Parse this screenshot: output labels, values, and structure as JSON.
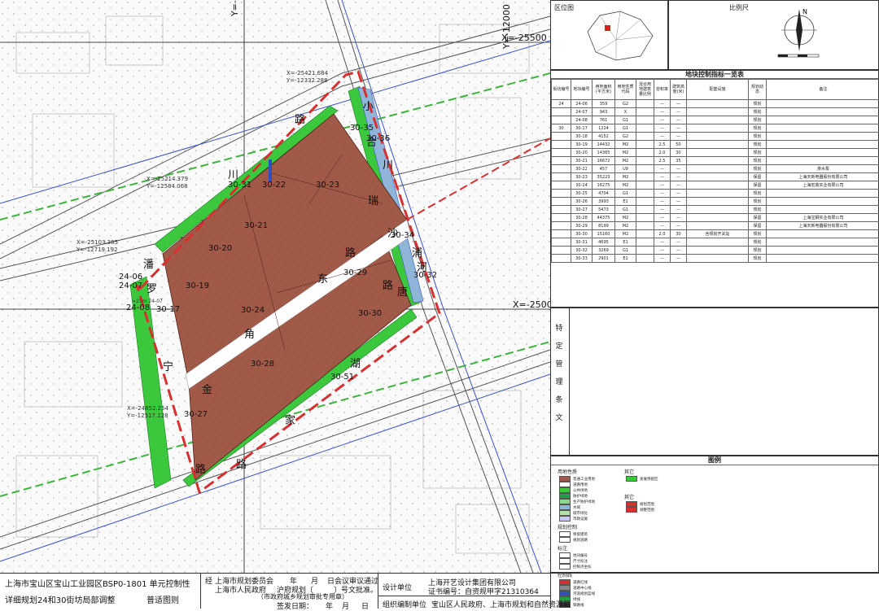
{
  "map": {
    "parcels": [
      "30-35",
      "30-36",
      "30-31",
      "30-22",
      "30-23",
      "30-21",
      "30-20",
      "30-19",
      "30-24",
      "30-17",
      "30-34",
      "30-32",
      "30-29",
      "30-30",
      "30-28",
      "30-51",
      "30-27",
      "24-06",
      "24-07",
      "24-08"
    ],
    "roads": [
      "路",
      "小",
      "川",
      "合",
      "川",
      "瑞",
      "罗",
      "潘",
      "东",
      "路",
      "宁",
      "角",
      "金",
      "路",
      "沙",
      "浦",
      "唐",
      "湖",
      "家",
      "路",
      "路",
      "河"
    ],
    "grid_labels": [
      "Y=-12500",
      "Y=-12000",
      "X=-25500",
      "X=-25000"
    ],
    "coords": [
      "X=-25421.684",
      "Y=-12332.288",
      "X=-25214.379",
      "Y=-12584.068",
      "X=-25103.385",
      "Y=-12719.192",
      "X=-24852.254",
      "Y=-12517.128"
    ],
    "dot_note": "≈25m 24-07"
  },
  "location_box": {
    "title": "区位图"
  },
  "scale_box": {
    "title": "比例尺",
    "north": "N"
  },
  "table": {
    "title": "地块控制指标一览表",
    "headers": [
      "街坊编号",
      "地块编号",
      "用地面积(平方米)",
      "用地性质代码",
      "混合用地建筑量比例",
      "容积率",
      "建筑高度(米)",
      "配套设施",
      "规划动态",
      "备注"
    ],
    "rows": [
      [
        "24",
        "24-06",
        "359",
        "G2",
        "",
        "—",
        "—",
        "",
        "规划",
        ""
      ],
      [
        "",
        "24-07",
        "943",
        "X",
        "",
        "—",
        "—",
        "",
        "规划",
        ""
      ],
      [
        "",
        "24-08",
        "761",
        "G1",
        "",
        "—",
        "—",
        "",
        "规划",
        ""
      ],
      [
        "30",
        "30-17",
        "1224",
        "G1",
        "",
        "—",
        "—",
        "",
        "规划",
        ""
      ],
      [
        "",
        "30-18",
        "4152",
        "G2",
        "",
        "—",
        "—",
        "",
        "规划",
        ""
      ],
      [
        "",
        "30-19",
        "14432",
        "M2",
        "",
        "2.5",
        "50",
        "",
        "规划",
        ""
      ],
      [
        "",
        "30-20",
        "14365",
        "M2",
        "",
        "2.0",
        "30",
        "",
        "规划",
        ""
      ],
      [
        "",
        "30-21",
        "16672",
        "M2",
        "",
        "2.5",
        "35",
        "",
        "规划",
        ""
      ],
      [
        "",
        "30-22",
        "457",
        "U9",
        "",
        "—",
        "—",
        "",
        "规划",
        "排水泵"
      ],
      [
        "",
        "30-23",
        "35223",
        "M2",
        "",
        "—",
        "—",
        "",
        "保留",
        "上海天新电器股份有限公司"
      ],
      [
        "",
        "30-24",
        "16275",
        "M2",
        "",
        "—",
        "—",
        "",
        "保留",
        "上海宏鼎实业有限公司"
      ],
      [
        "",
        "30-25",
        "4704",
        "G1",
        "",
        "—",
        "—",
        "",
        "规划",
        ""
      ],
      [
        "",
        "30-26",
        "3993",
        "E1",
        "",
        "—",
        "—",
        "",
        "规划",
        ""
      ],
      [
        "",
        "30-27",
        "5473",
        "G1",
        "",
        "—",
        "—",
        "",
        "规划",
        ""
      ],
      [
        "",
        "30-28",
        "44375",
        "M2",
        "",
        "—",
        "—",
        "",
        "保留",
        "上海宝钢实业有限公司"
      ],
      [
        "",
        "30-29",
        "8199",
        "M2",
        "",
        "—",
        "—",
        "",
        "保留",
        "上海天新电器股份有限公司"
      ],
      [
        "",
        "30-30",
        "15160",
        "M2",
        "",
        "2.0",
        "30",
        "含规划开关站",
        "规划",
        ""
      ],
      [
        "",
        "30-31",
        "4695",
        "E1",
        "",
        "—",
        "—",
        "",
        "规划",
        ""
      ],
      [
        "",
        "30-32",
        "3269",
        "G1",
        "",
        "—",
        "—",
        "",
        "规划",
        ""
      ],
      [
        "",
        "30-33",
        "2901",
        "E1",
        "",
        "—",
        "—",
        "",
        "规划",
        ""
      ]
    ]
  },
  "special_box": {
    "title": "特定管理条文"
  },
  "legend": {
    "title": "图例",
    "land_use_title": "用地性质",
    "land_use": [
      {
        "label": "普通工业用地",
        "color": "#9c5a4a"
      },
      {
        "label": "道路用地",
        "color": "#ffffff"
      },
      {
        "label": "公共绿地",
        "color": "#3cc83c"
      },
      {
        "label": "防护绿地",
        "color": "#1f9e4a"
      },
      {
        "label": "生产防护绿地",
        "color": "#8fd48f"
      },
      {
        "label": "水域",
        "color": "#8fb6d8"
      },
      {
        "label": "城市绿化",
        "color": "#b4e0b4"
      },
      {
        "label": "市政设施",
        "color": "#c8c8ff"
      }
    ],
    "other_title": "其它",
    "other": [
      {
        "label": "发展预留区",
        "color": "#3cc83c"
      }
    ],
    "other2_title": "其它",
    "other2": [
      {
        "label": "规划范围",
        "color": "#d83030"
      },
      {
        "label": "调整范围",
        "color": "#d83030"
      }
    ],
    "plan_title": "规划控制",
    "plan": [
      {
        "label": "保留建筑",
        "color": "#ffffff"
      },
      {
        "label": "规划道路",
        "color": "#ffffff"
      }
    ],
    "mark_title": "标注",
    "mark": [
      {
        "label": "地块编号",
        "color": "#ffffff"
      },
      {
        "label": "尺寸标注",
        "color": "#ffffff"
      },
      {
        "label": "控制点坐标",
        "color": "#ffffff"
      }
    ],
    "line_title": "控制线",
    "line": [
      {
        "label": "道路红线",
        "color": "#d83030"
      },
      {
        "label": "道路中心线",
        "color": "#888888"
      },
      {
        "label": "河道规划蓝线",
        "color": "#3050c0"
      },
      {
        "label": "绿线",
        "color": "#20a040"
      },
      {
        "label": "铁路线",
        "color": "#333333"
      }
    ]
  },
  "footer": {
    "title1": "上海市宝山区宝山工业园区BSP0-1801 单元控制性",
    "title2": "详细规划24和30街坊局部调整",
    "drawing_type": "普适图则",
    "approve_label": "经",
    "committee": "上海市规划委员会",
    "year_mark": "年",
    "month_mark": "月",
    "meeting": "日会议审议通过",
    "government": "上海市人民政府",
    "doc": "沪府规划〔",
    "doc_end": "〕号文批准。",
    "gov_office": "（市政府城乡规划审批专用章）",
    "sign_date": "签发日期：",
    "day_mark": "日",
    "design_label": "设计单位",
    "design_company": "上海开艺设计集团有限公司",
    "cert": "证书编号：自资规甲字21310364",
    "org_label": "组织编制单位",
    "org_names": "宝山区人民政府、上海市规划和自然资源局"
  }
}
